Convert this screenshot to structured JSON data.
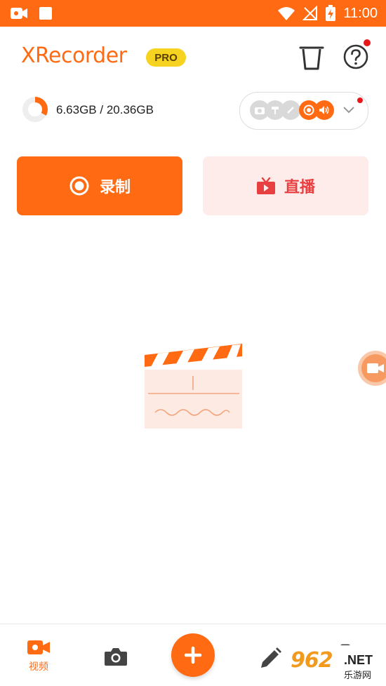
{
  "status_bar": {
    "time": "11:00",
    "bg_color": "#FF6A12"
  },
  "header": {
    "app_name": "XRecorder",
    "badge": "PRO",
    "trash_icon": "trash-icon",
    "help_icon": "help-icon"
  },
  "storage": {
    "used": "6.63GB",
    "separator": " / ",
    "total": "20.36GB",
    "used_fraction": 0.33
  },
  "tools": {
    "icons": [
      "camera-icon",
      "brush-icon",
      "pen-icon",
      "record-icon",
      "volume-icon"
    ],
    "dropdown_icon": "chevron-down-icon"
  },
  "actions": {
    "record_label": "录制",
    "live_label": "直播"
  },
  "bottom_nav": {
    "items": [
      {
        "label": "视频",
        "icon": "video-icon",
        "active": true
      },
      {
        "label": "",
        "icon": "camera-icon",
        "active": false
      },
      {
        "label": "",
        "icon": "plus-icon",
        "active": false
      },
      {
        "label": "",
        "icon": "edit-icon",
        "active": false
      },
      {
        "label": "",
        "icon": "toolbox-icon",
        "active": false
      }
    ]
  },
  "watermark": {
    "number": "962",
    "domain": ".NET",
    "sub": "乐游网"
  },
  "colors": {
    "accent": "#FF6A12",
    "accent_light": "#FDECEA",
    "live_red": "#E84040",
    "pro_yellow": "#F6D221",
    "notification_red": "#E8181A"
  }
}
